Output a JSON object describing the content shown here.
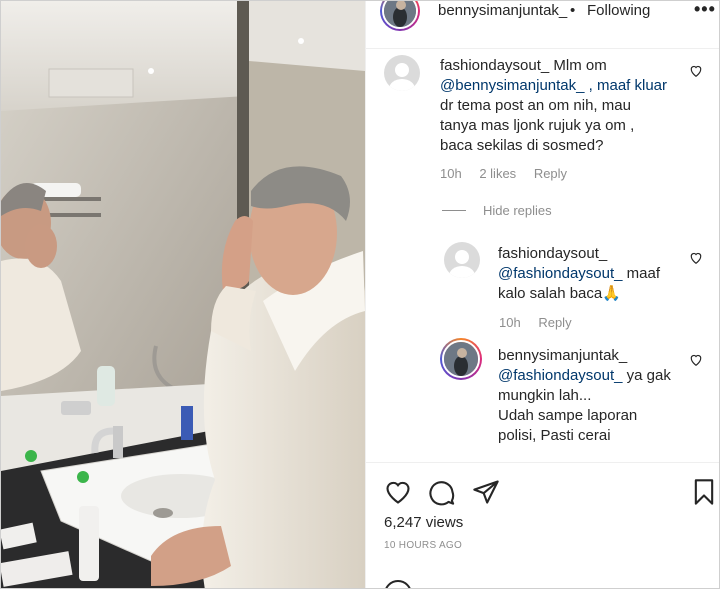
{
  "header": {
    "username": "bennysimanjuntak_",
    "separator": "•",
    "follow_status": "Following",
    "more_glyph": "•••"
  },
  "comments": [
    {
      "username": "fashiondaysout_",
      "text_lines": [
        "Mlm om",
        "@bennysimanjuntak_ , maaf kluar",
        "dr tema post an om nih, mau",
        "tanya mas ljonk rujuk ya om ,",
        "baca sekilas di sosmed?"
      ],
      "mention": "@bennysimanjuntak_",
      "time": "10h",
      "likes": "2 likes",
      "reply_label": "Reply"
    }
  ],
  "hide_replies_label": "Hide replies",
  "replies": [
    {
      "username": "fashiondaysout_",
      "mention": "@fashiondaysout_",
      "text_after_mention": " maaf",
      "text_line2": "kalo salah baca🙏",
      "time": "10h",
      "reply_label": "Reply"
    },
    {
      "username": "bennysimanjuntak_",
      "mention": "@fashiondaysout_",
      "text_after_mention": " ya gak",
      "text_line2": "mungkin lah...",
      "text_line3": "Udah sampe laporan",
      "text_line4": "polisi, Pasti cerai"
    }
  ],
  "actions": {
    "views": "6,247 views",
    "time_ago": "10 HOURS AGO"
  },
  "icons": {
    "like": "heart-icon",
    "comment": "comment-bubble-icon",
    "share": "paper-plane-icon",
    "save": "bookmark-icon"
  },
  "colors": {
    "text": "#262626",
    "muted": "#8e8e8e",
    "mention": "#00376b",
    "divider": "#efefef"
  }
}
